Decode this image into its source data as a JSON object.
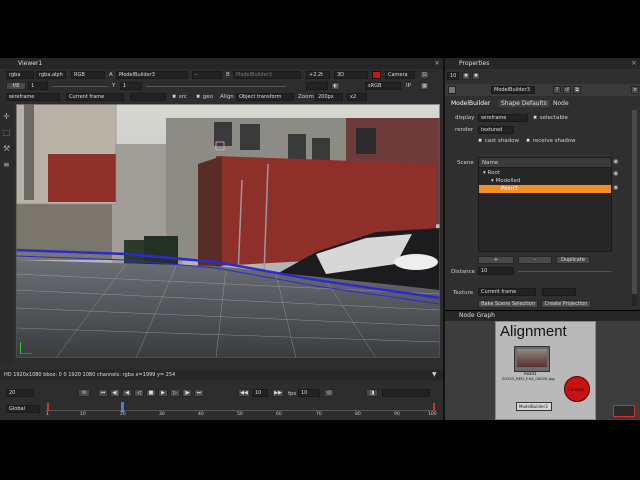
{
  "viewer": {
    "tab_label": "Viewer1",
    "row1": {
      "channels": "rgba",
      "layer": "rgba.alph",
      "display_channels": "RGB",
      "input_a_label": "A",
      "input_a": "ModelBuilder3",
      "blend": "-",
      "input_b_label": "B",
      "input_b": "ModelBuilder3",
      "gain_value": "+2.2t",
      "view_mode": "3D",
      "camera": "Camera"
    },
    "row2": {
      "fstop": "f/8",
      "gain": "1",
      "y_label": "Y",
      "gamma": "1",
      "colorspace": "sRGB",
      "ip": "IP"
    },
    "row3": {
      "render_mode": "wireframe",
      "frame_mode": "Current frame",
      "src_label": "src",
      "geo_label": "geo",
      "align_label": "Align",
      "align_mode": "Object transform",
      "zoom_label": "Zoom",
      "zoom_value": "200px",
      "scale": "x2"
    },
    "status_line": "HD 1920x1080 bbox: 0 0 1920 1080 channels: rgba  x=1999 y= 254",
    "timeline": {
      "current_frame": "20",
      "scope": "Global",
      "step": "10",
      "fps_label": "fps",
      "fps": "10",
      "ticks": [
        "1",
        "10",
        "20",
        "30",
        "40",
        "50",
        "60",
        "70",
        "80",
        "90",
        "100"
      ]
    }
  },
  "properties": {
    "tab_label": "Properties",
    "max_panels": "10",
    "node_name": "ModelBuilder3",
    "tabs": [
      "ModelBuilder",
      "Shape Defaults",
      "Node"
    ],
    "display_label": "display",
    "display_value": "wireframe",
    "selectable_label": "selectable",
    "render_label": "render",
    "render_value": "textured",
    "cast_shadow_label": "cast shadow",
    "receive_shadow_label": "receive shadow",
    "scene_label": "Scene",
    "scene_header": "Name",
    "scene_tree": [
      "Root",
      "Modelled",
      "Point1"
    ],
    "add_btn": "+",
    "remove_btn": "-",
    "duplicate_btn": "Duplicate",
    "distance_label": "Distance",
    "distance_value": "10",
    "texture_label": "Texture",
    "texture_value": "Current frame",
    "bake_btn": "Bake Scene Selection",
    "projection_btn": "Create Projection"
  },
  "node_graph": {
    "tab_label": "Node Graph",
    "backdrop_title": "Alignment",
    "read_node_label": "Read1",
    "read_node_file": "00253_RED_F.04_00020.jpg",
    "modelbuilder_node": "ModelBuilder3",
    "camera_node": "Camera"
  },
  "colors": {
    "accent_orange": "#f0912a",
    "camera_red": "#cc1111",
    "wire_blue": "#2b2bd0"
  }
}
